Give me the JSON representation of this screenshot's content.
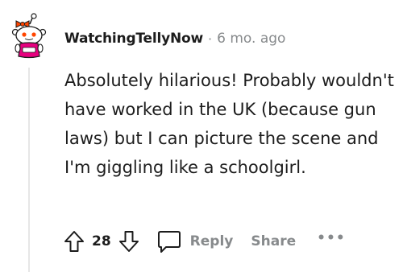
{
  "comment": {
    "username": "WatchingTellyNow",
    "separator": "·",
    "age": "6 mo. ago",
    "text": "Absolutely hilarious! Probably wouldn't have worked in the UK (because gun laws) but I can picture the scene and I'm giggling like a schoolgirl.",
    "score": "28",
    "actions": {
      "reply_label": "Reply",
      "share_label": "Share",
      "more_label": "•••"
    }
  },
  "icons": {
    "avatar": "snoo-avatar-icon",
    "upvote": "upvote-arrow-icon",
    "downvote": "downvote-arrow-icon",
    "reply": "speech-bubble-icon"
  },
  "colors": {
    "text": "#1c1c1c",
    "meta": "#878a8c",
    "thread_line": "#e6e6e6",
    "avatar_accent": "#e6007e",
    "avatar_red": "#ff4500"
  }
}
